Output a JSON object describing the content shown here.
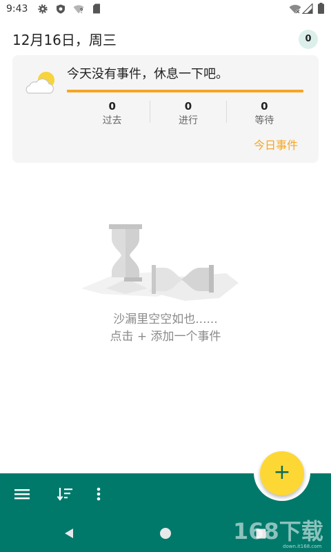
{
  "status_bar": {
    "time": "9:43",
    "icons": {
      "left": [
        "gear-icon",
        "shield-icon",
        "wifi-question-icon",
        "sd-card-icon"
      ],
      "right": [
        "wifi-off-icon",
        "cell-signal-icon",
        "battery-icon"
      ]
    }
  },
  "header": {
    "date": "12月16日，周三",
    "badge_count": "0"
  },
  "summary_card": {
    "weather_icon": "partly-sunny-icon",
    "message": "今天没有事件，休息一下吧。",
    "stats": [
      {
        "value": "0",
        "label": "过去"
      },
      {
        "value": "0",
        "label": "进行"
      },
      {
        "value": "0",
        "label": "等待"
      }
    ],
    "today_link": "今日事件"
  },
  "empty_state": {
    "illustration": "hourglass-illustration",
    "title": "沙漏里空空如也......",
    "hint": "点击 + 添加一个事件"
  },
  "bottom_app_bar": {
    "icons": [
      "menu-icon",
      "sort-icon",
      "more-vert-icon"
    ],
    "fab_label": "+"
  },
  "system_nav": {
    "icons": [
      "back-icon",
      "home-icon",
      "recents-icon"
    ]
  },
  "watermark": {
    "brand": "168下载",
    "domain": "down.it168.com"
  },
  "colors": {
    "primary": "#00796B",
    "fab": "#FDD835",
    "accent": "#F5A623",
    "card_background": "#F5F5F5",
    "badge_background": "#DCEFEA"
  }
}
